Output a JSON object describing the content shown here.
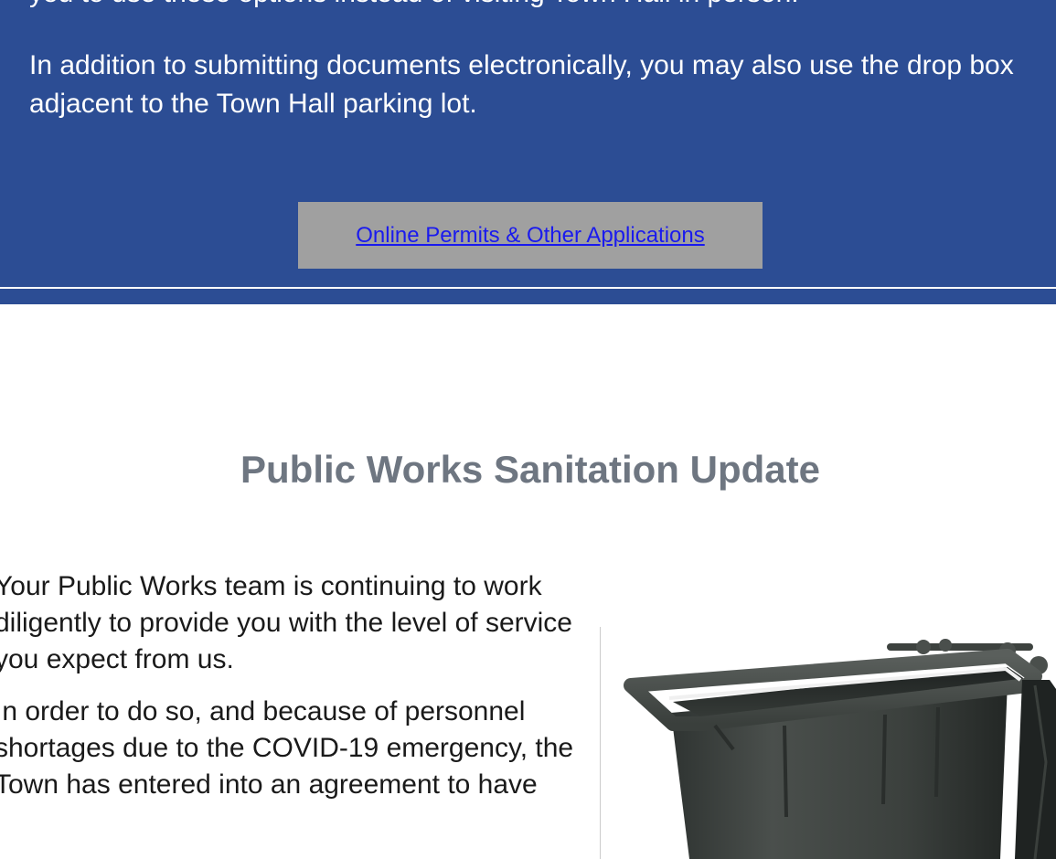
{
  "announcement": {
    "paragraph_top_partial": "you to use these options instead of visiting Town Hall in person.",
    "paragraph_dropbox": "In addition to submitting documents electronically, you may also use the drop box adjacent to the Town Hall parking lot.",
    "button_label": "Online Permits & Other Applications"
  },
  "sanitation": {
    "title": "Public Works Sanitation Update",
    "paragraph_1": "Your Public Works team is continuing to work diligently to provide you with the level of service you expect from us.",
    "paragraph_2": "In order to do so, and because of personnel shortages due to the COVID-19 emergency, the Town has entered into an agreement to have"
  },
  "colors": {
    "panel_background": "#2c4d94",
    "button_background": "#a0a0a0",
    "link_color": "#1a1aee",
    "title_color": "#6e7681"
  }
}
